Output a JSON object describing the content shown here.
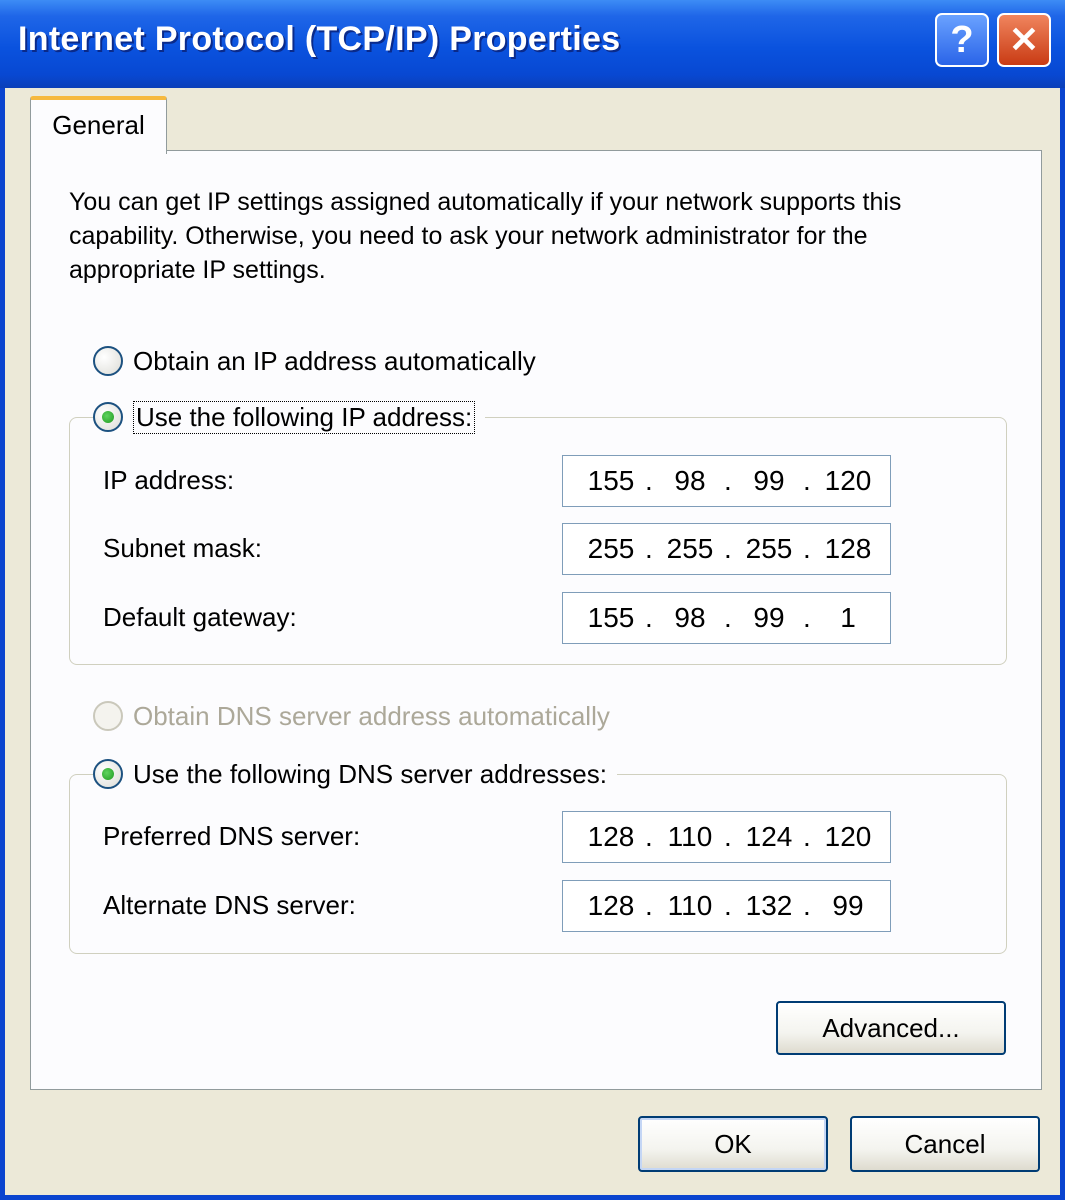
{
  "window": {
    "title": "Internet Protocol (TCP/IP) Properties",
    "help_label": "?",
    "close_label": "✕"
  },
  "tabs": [
    {
      "label": "General",
      "selected": true
    }
  ],
  "intro_text": "You can get IP settings assigned automatically if your network supports this capability. Otherwise, you need to ask your network administrator for the appropriate IP settings.",
  "ip_mode": {
    "auto_label": "Obtain an IP address automatically",
    "manual_label": "Use the following IP address:",
    "selected": "manual"
  },
  "ip_fields": [
    {
      "label": "IP address:",
      "octets": [
        "155",
        "98",
        "99",
        "120"
      ]
    },
    {
      "label": "Subnet mask:",
      "octets": [
        "255",
        "255",
        "255",
        "128"
      ]
    },
    {
      "label": "Default gateway:",
      "octets": [
        "155",
        "98",
        "99",
        "1"
      ]
    }
  ],
  "dns_mode": {
    "auto_label": "Obtain DNS server address automatically",
    "manual_label": "Use the following DNS server addresses:",
    "selected": "manual",
    "auto_disabled": true
  },
  "dns_fields": [
    {
      "label": "Preferred DNS server:",
      "octets": [
        "128",
        "110",
        "124",
        "120"
      ]
    },
    {
      "label": "Alternate DNS server:",
      "octets": [
        "128",
        "110",
        "132",
        "99"
      ]
    }
  ],
  "buttons": {
    "advanced": "Advanced...",
    "ok": "OK",
    "cancel": "Cancel"
  },
  "colors": {
    "title_bar": "#0a52de",
    "dialog_bg": "#ece9d8",
    "tab_accent": "#f6b93e",
    "radio_dot": "#1f9a1f"
  }
}
